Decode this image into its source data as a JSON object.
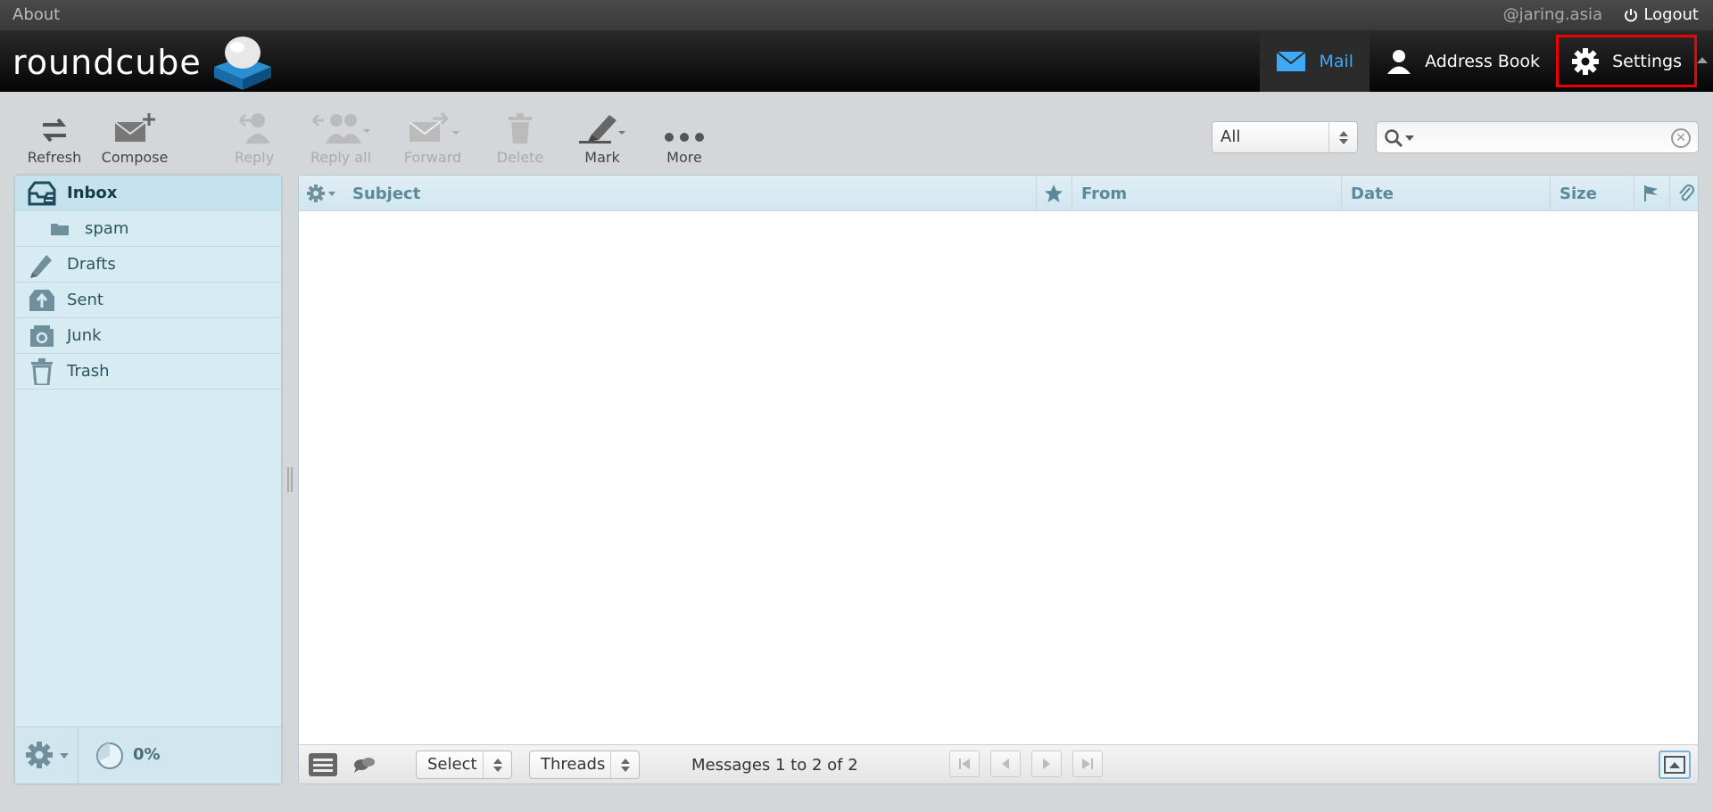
{
  "topline": {
    "about": "About",
    "user": "@jaring.asia",
    "logout": "Logout"
  },
  "logo": {
    "text": "roundcube"
  },
  "taskbar": {
    "mail": "Mail",
    "addressbook": "Address Book",
    "settings": "Settings"
  },
  "toolbar": {
    "refresh": "Refresh",
    "compose": "Compose",
    "reply": "Reply",
    "reply_all": "Reply all",
    "forward": "Forward",
    "delete": "Delete",
    "mark": "Mark",
    "more": "More"
  },
  "filter": {
    "selected": "All"
  },
  "search": {
    "value": ""
  },
  "folders": [
    {
      "name": "Inbox",
      "icon": "inbox-icon",
      "selected": true
    },
    {
      "name": "spam",
      "icon": "folder-icon",
      "sub": true
    },
    {
      "name": "Drafts",
      "icon": "pencil-icon"
    },
    {
      "name": "Sent",
      "icon": "sent-icon"
    },
    {
      "name": "Junk",
      "icon": "junk-icon"
    },
    {
      "name": "Trash",
      "icon": "trash-icon"
    }
  ],
  "quota": {
    "text": "0%"
  },
  "list": {
    "columns": {
      "subject": "Subject",
      "from": "From",
      "date": "Date",
      "size": "Size"
    },
    "select_label": "Select",
    "threads_label": "Threads",
    "count_text": "Messages 1 to 2 of 2"
  },
  "colors": {
    "accent": "#3fa9f5",
    "highlight": "#e00000",
    "panel": "#d7ebf3"
  }
}
